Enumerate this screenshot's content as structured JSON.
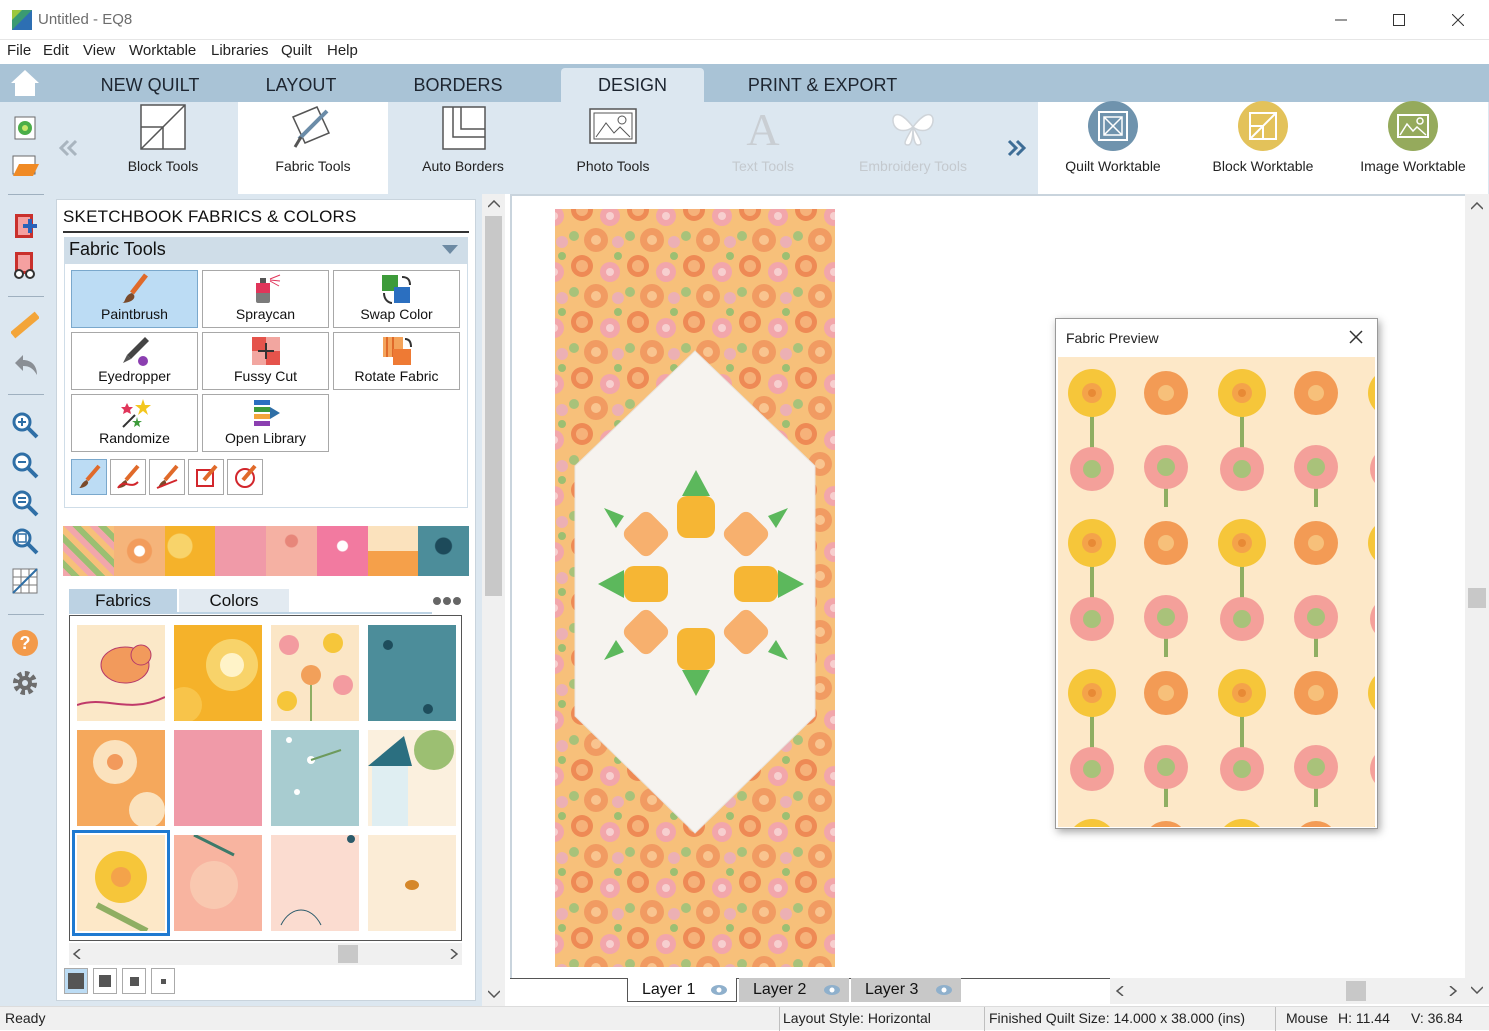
{
  "window": {
    "title": "Untitled - EQ8"
  },
  "menu": [
    "File",
    "Edit",
    "View",
    "Worktable",
    "Libraries",
    "Quilt",
    "Help"
  ],
  "tabs": [
    {
      "label": "NEW QUILT"
    },
    {
      "label": "LAYOUT"
    },
    {
      "label": "BORDERS"
    },
    {
      "label": "DESIGN",
      "active": true
    },
    {
      "label": "PRINT & EXPORT"
    }
  ],
  "ribbon": {
    "tools": [
      {
        "label": "Block Tools",
        "icon": "block-tools-icon"
      },
      {
        "label": "Fabric Tools",
        "icon": "fabric-tools-icon",
        "active": true
      },
      {
        "label": "Auto Borders",
        "icon": "auto-borders-icon"
      },
      {
        "label": "Photo Tools",
        "icon": "photo-tools-icon"
      },
      {
        "label": "Text Tools",
        "icon": "text-tools-icon",
        "disabled": true
      },
      {
        "label": "Embroidery Tools",
        "icon": "embroidery-tools-icon",
        "disabled": true
      }
    ],
    "worktables": [
      {
        "label": "Quilt Worktable",
        "color": "#6f93ad"
      },
      {
        "label": "Block Worktable",
        "color": "#e3c25a"
      },
      {
        "label": "Image Worktable",
        "color": "#95aa5c"
      }
    ]
  },
  "panel": {
    "title": "SKETCHBOOK FABRICS & COLORS",
    "section": "Fabric Tools",
    "tools": [
      {
        "label": "Paintbrush",
        "icon": "paintbrush-icon",
        "selected": true
      },
      {
        "label": "Spraycan",
        "icon": "spraycan-icon"
      },
      {
        "label": "Swap Color",
        "icon": "swap-color-icon"
      },
      {
        "label": "Eyedropper",
        "icon": "eyedropper-icon"
      },
      {
        "label": "Fussy Cut",
        "icon": "fussy-cut-icon"
      },
      {
        "label": "Rotate Fabric",
        "icon": "rotate-fabric-icon"
      },
      {
        "label": "Randomize",
        "icon": "randomize-icon"
      },
      {
        "label": "Open Library",
        "icon": "open-library-icon"
      }
    ],
    "fabric_tabs": {
      "fabrics": "Fabrics",
      "colors": "Colors"
    }
  },
  "layers": [
    "Layer 1",
    "Layer 2",
    "Layer 3"
  ],
  "preview": {
    "title": "Fabric Preview"
  },
  "status": {
    "ready": "Ready",
    "layout_style": "Layout Style: Horizontal",
    "finished_size": "Finished Quilt Size: 14.000 x 38.000 (ins)",
    "mouse": "Mouse",
    "h": "H:  11.44",
    "v": "V:  36.84"
  }
}
